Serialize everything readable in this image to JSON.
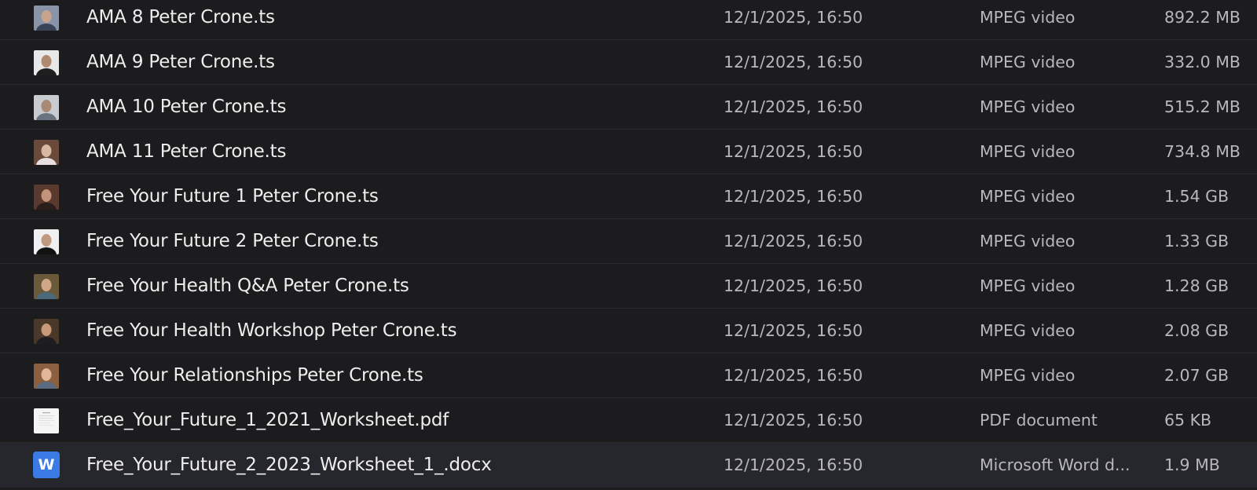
{
  "rows": [
    {
      "name": "AMA 8 Peter Crone.ts",
      "date": "12/1/2025, 16:50",
      "kind": "MPEG video",
      "size": "892.2 MB",
      "icon": "video-thumbnail-icon",
      "palette": [
        "#8a94a8",
        "#c9a48c",
        "#3a4458"
      ]
    },
    {
      "name": "AMA 9 Peter Crone.ts",
      "date": "12/1/2025, 16:50",
      "kind": "MPEG video",
      "size": "332.0 MB",
      "icon": "video-thumbnail-icon",
      "palette": [
        "#e8e8e8",
        "#b08a70",
        "#1e1e1e"
      ]
    },
    {
      "name": "AMA 10 Peter Crone.ts",
      "date": "12/1/2025, 16:50",
      "kind": "MPEG video",
      "size": "515.2 MB",
      "icon": "video-thumbnail-icon",
      "palette": [
        "#c8ccd0",
        "#a88a74",
        "#6a7480"
      ]
    },
    {
      "name": "AMA 11 Peter Crone.ts",
      "date": "12/1/2025, 16:50",
      "kind": "MPEG video",
      "size": "734.8 MB",
      "icon": "video-thumbnail-icon",
      "palette": [
        "#6a4a3a",
        "#d8b8a0",
        "#e8e0e0"
      ]
    },
    {
      "name": "Free Your Future 1 Peter Crone.ts",
      "date": "12/1/2025, 16:50",
      "kind": "MPEG video",
      "size": "1.54 GB",
      "icon": "video-thumbnail-icon",
      "palette": [
        "#5a3a2e",
        "#c4947a",
        "#2a1e1a"
      ]
    },
    {
      "name": "Free Your Future 2 Peter Crone.ts",
      "date": "12/1/2025, 16:50",
      "kind": "MPEG video",
      "size": "1.33 GB",
      "icon": "video-thumbnail-icon",
      "palette": [
        "#f0f0f0",
        "#c09a80",
        "#111111"
      ]
    },
    {
      "name": "Free Your Health Q&A Peter Crone.ts",
      "date": "12/1/2025, 16:50",
      "kind": "MPEG video",
      "size": "1.28 GB",
      "icon": "video-thumbnail-icon",
      "palette": [
        "#6a5a3a",
        "#d0a888",
        "#4a6a7a"
      ]
    },
    {
      "name": "Free Your Health Workshop Peter Crone.ts",
      "date": "12/1/2025, 16:50",
      "kind": "MPEG video",
      "size": "2.08 GB",
      "icon": "video-thumbnail-icon",
      "palette": [
        "#4a3828",
        "#c89a78",
        "#1e1e22"
      ]
    },
    {
      "name": "Free Your Relationships Peter Crone.ts",
      "date": "12/1/2025, 16:50",
      "kind": "MPEG video",
      "size": "2.07 GB",
      "icon": "video-thumbnail-icon",
      "palette": [
        "#8a6040",
        "#e0b898",
        "#5a6a80"
      ]
    },
    {
      "name": "Free_Your_Future_1_2021_Worksheet.pdf",
      "date": "12/1/2025, 16:50",
      "kind": "PDF document",
      "size": "65 KB",
      "icon": "pdf-document-icon"
    },
    {
      "name": "Free_Your_Future_2_2023_Worksheet_1_.docx",
      "date": "12/1/2025, 16:50",
      "kind": "Microsoft Word d...",
      "size": "1.9 MB",
      "icon": "word-document-icon",
      "icon_letter": "W",
      "selected": true
    }
  ]
}
